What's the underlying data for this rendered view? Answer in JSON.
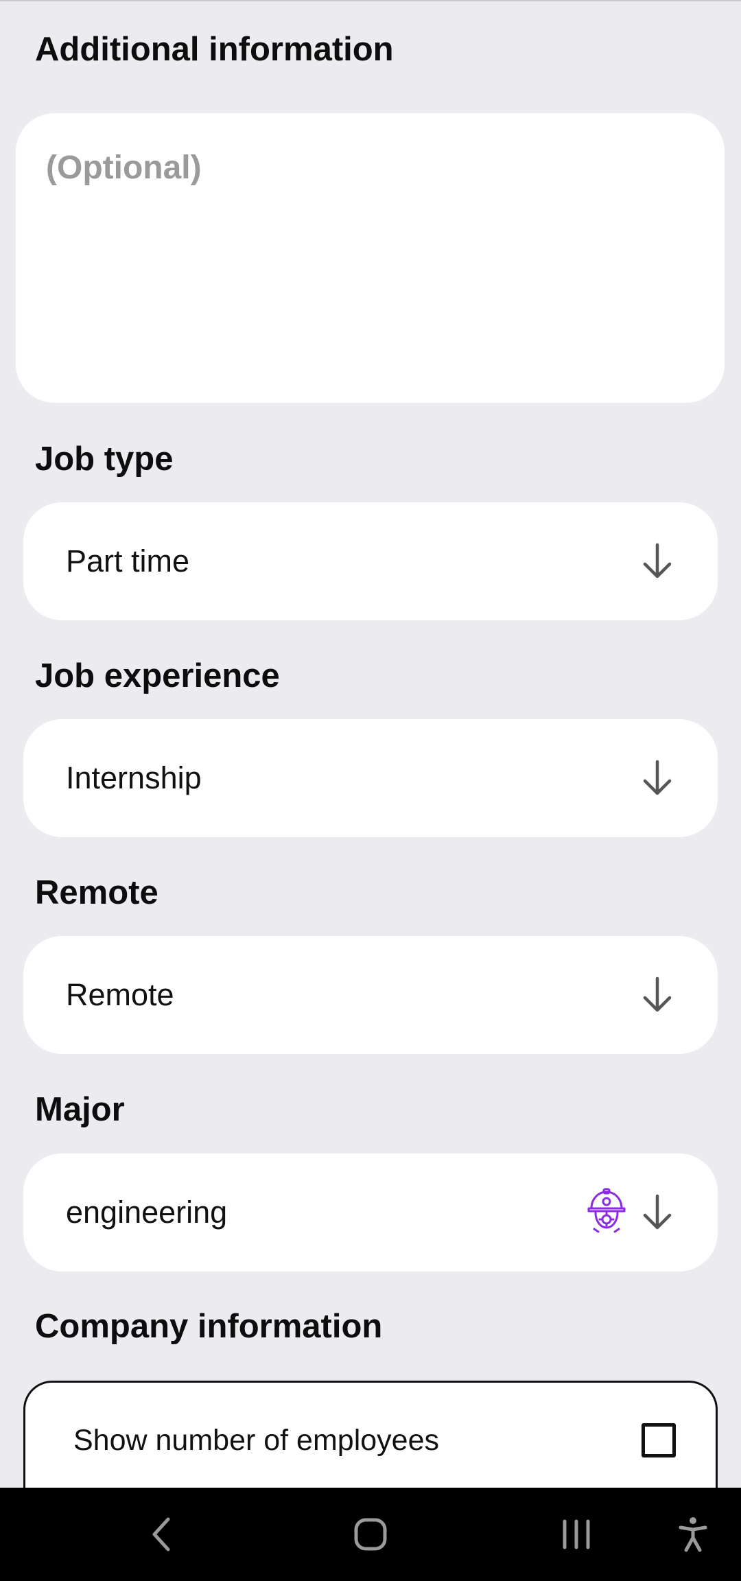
{
  "additional_info": {
    "title": "Additional information",
    "placeholder": "(Optional)"
  },
  "job_type": {
    "title": "Job type",
    "value": "Part time"
  },
  "job_experience": {
    "title": "Job experience",
    "value": "Internship"
  },
  "remote": {
    "title": "Remote",
    "value": "Remote"
  },
  "major": {
    "title": "Major",
    "value": "engineering",
    "icon": "engineer-helmet-icon",
    "icon_color": "#8a2be2"
  },
  "company_info": {
    "title": "Company information",
    "show_employees_label": "Show number of employees",
    "show_employees_checked": false
  },
  "nav_bar": {
    "buttons": [
      "back-icon",
      "home-icon",
      "recents-icon",
      "accessibility-icon"
    ]
  },
  "colors": {
    "background": "#ebebf0",
    "card": "#ffffff",
    "placeholder": "#9a9a9a",
    "text": "#111111",
    "nav_bar": "#000000"
  }
}
